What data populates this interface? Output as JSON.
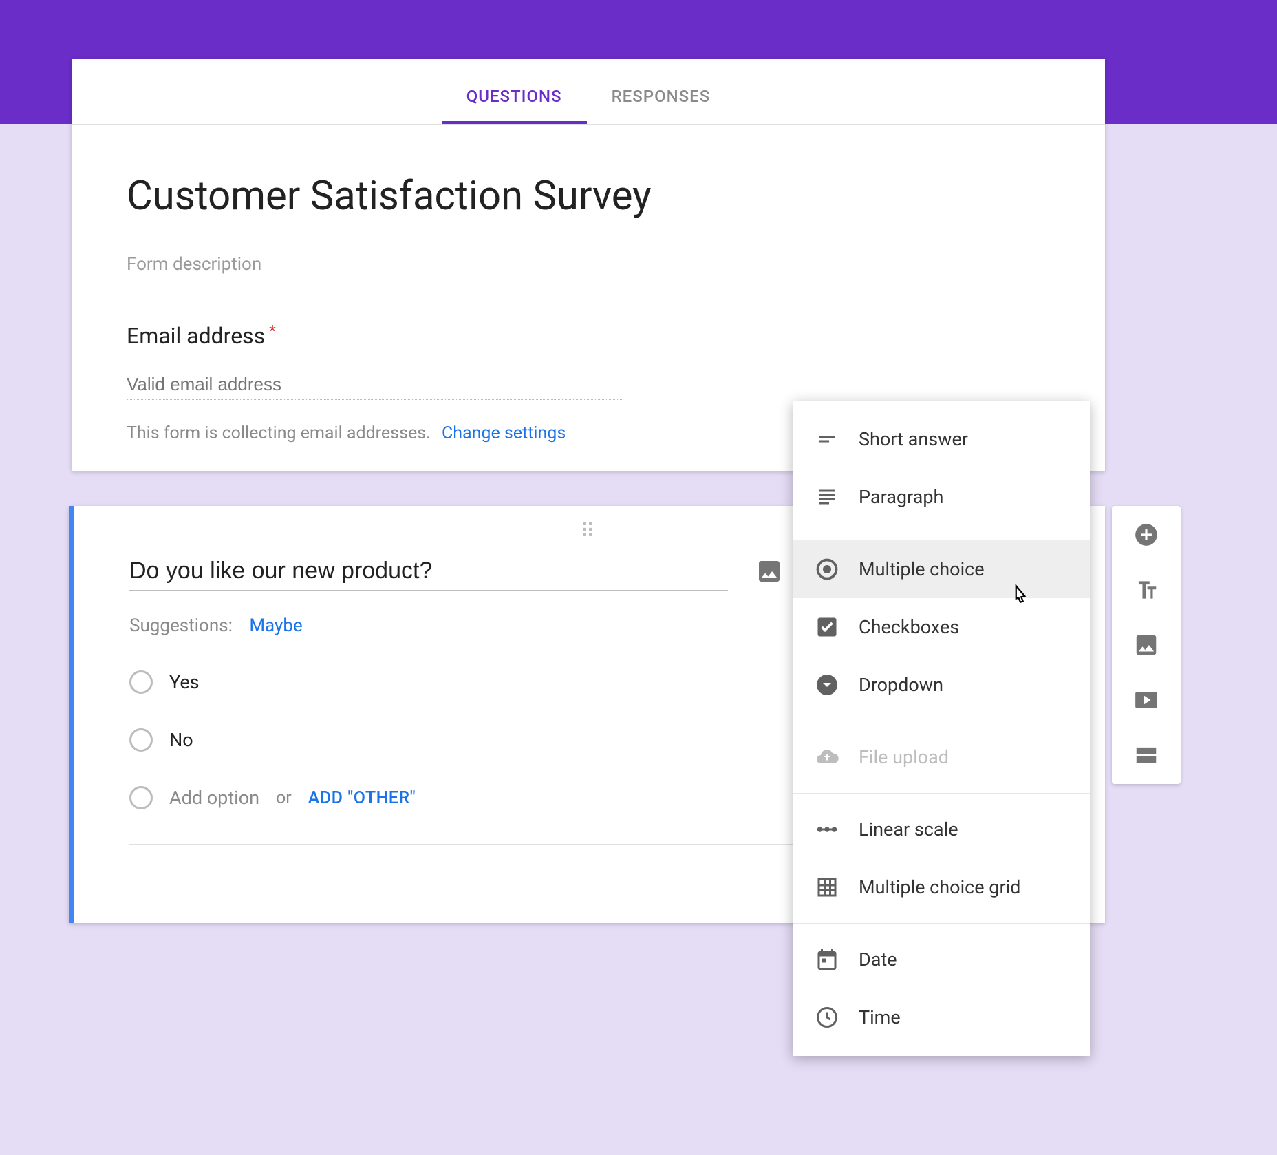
{
  "tabs": {
    "questions": "QUESTIONS",
    "responses": "RESPONSES",
    "active": "questions"
  },
  "form": {
    "title": "Customer Satisfaction Survey",
    "description_placeholder": "Form description",
    "email": {
      "label": "Email address",
      "placeholder": "Valid email address",
      "note": "This form is collecting email addresses.",
      "change_link": "Change settings"
    }
  },
  "question": {
    "text": "Do you like our new product?",
    "suggestions_label": "Suggestions:",
    "suggestions": [
      "Maybe"
    ],
    "options": [
      "Yes",
      "No"
    ],
    "add_option_placeholder": "Add option",
    "or_text": "or",
    "add_other": "ADD \"OTHER\""
  },
  "type_menu": {
    "groups": [
      [
        {
          "key": "short_answer",
          "label": "Short answer",
          "icon": "short-text"
        },
        {
          "key": "paragraph",
          "label": "Paragraph",
          "icon": "subject"
        }
      ],
      [
        {
          "key": "multiple_choice",
          "label": "Multiple choice",
          "icon": "radio",
          "selected": true
        },
        {
          "key": "checkboxes",
          "label": "Checkboxes",
          "icon": "checkbox"
        },
        {
          "key": "dropdown",
          "label": "Dropdown",
          "icon": "dropdown-circle"
        }
      ],
      [
        {
          "key": "file_upload",
          "label": "File upload",
          "icon": "cloud-upload",
          "disabled": true
        }
      ],
      [
        {
          "key": "linear_scale",
          "label": "Linear scale",
          "icon": "linear"
        },
        {
          "key": "mc_grid",
          "label": "Multiple choice grid",
          "icon": "grid"
        }
      ],
      [
        {
          "key": "date",
          "label": "Date",
          "icon": "calendar"
        },
        {
          "key": "time",
          "label": "Time",
          "icon": "clock"
        }
      ]
    ]
  },
  "sidebar_tools": [
    "add-question",
    "add-title",
    "add-image",
    "add-video",
    "add-section"
  ]
}
